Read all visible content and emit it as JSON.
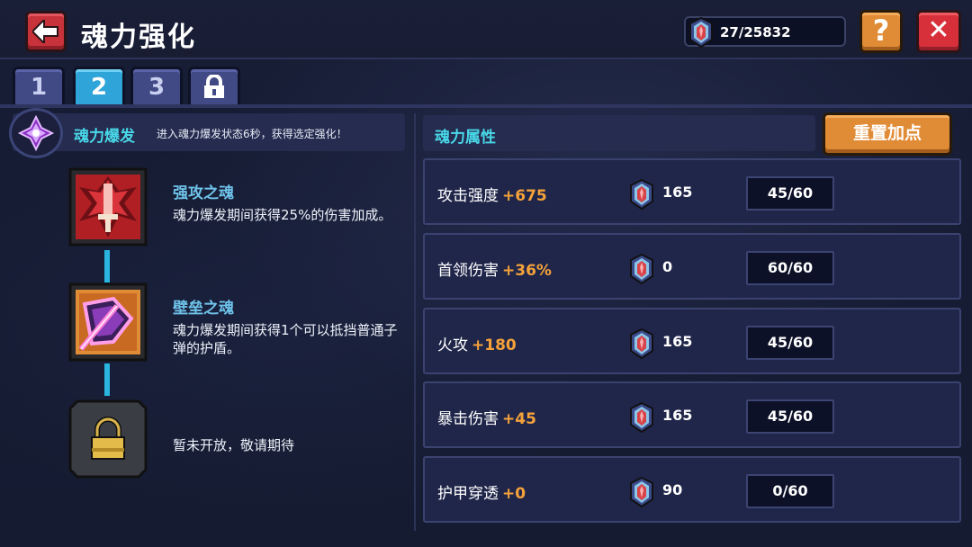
{
  "header": {
    "title": "魂力强化",
    "currency_value": "27/25832",
    "help_label": "?",
    "close_label": "✕"
  },
  "tabs": [
    {
      "label": "1"
    },
    {
      "label": "2"
    },
    {
      "label": "3"
    },
    {
      "label": ""
    }
  ],
  "active_tab": "2",
  "burst": {
    "name": "魂力爆发",
    "description": "进入魂力爆发状态6秒，获得选定强化！"
  },
  "skills": [
    {
      "name": "强攻之魂",
      "description": "魂力爆发期间获得25%的伤害加成。",
      "icon": "sword-soul-icon"
    },
    {
      "name": "壁垒之魂",
      "description": "魂力爆发期间获得1个可以抵挡普通子弹的护盾。",
      "icon": "shield-soul-icon"
    }
  ],
  "locked_slot": {
    "text": "暂未开放，敬请期待",
    "icon": "lock-icon"
  },
  "attributes_panel": {
    "title": "魂力属性",
    "reset_label": "重置加点"
  },
  "attributes": [
    {
      "name": "攻击强度",
      "bonus": "+675",
      "cost": "165",
      "level": "45/60"
    },
    {
      "name": "首领伤害",
      "bonus": "+36%",
      "cost": "0",
      "level": "60/60"
    },
    {
      "name": "火攻",
      "bonus": "+180",
      "cost": "165",
      "level": "45/60"
    },
    {
      "name": "暴击伤害",
      "bonus": "+45",
      "cost": "165",
      "level": "45/60"
    },
    {
      "name": "护甲穿透",
      "bonus": "+0",
      "cost": "90",
      "level": "0/60"
    }
  ],
  "colors": {
    "accent_cyan": "#49d8e8",
    "bonus_orange": "#f5a23a",
    "button_orange": "#e08b35",
    "button_red": "#d8303a",
    "tab_active": "#2ea4d8",
    "tab_inactive": "#424a86"
  }
}
